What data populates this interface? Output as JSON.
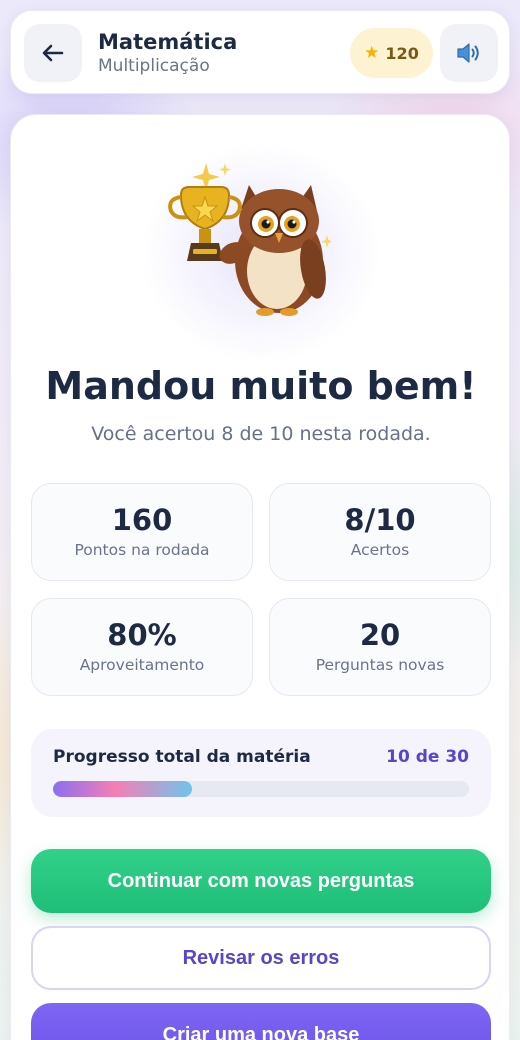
{
  "header": {
    "back_icon": "arrow-left-icon",
    "title": "Matemática",
    "subtitle": "Multiplicação",
    "score": "120",
    "score_icon": "star-icon",
    "sound_icon": "speaker-icon"
  },
  "result": {
    "mascot": "owl-with-trophy",
    "headline": "Mandou muito bem!",
    "summary": "Você acertou 8 de 10 nesta rodada."
  },
  "stats": [
    {
      "value": "160",
      "label": "Pontos na rodada"
    },
    {
      "value": "8/10",
      "label": "Acertos"
    },
    {
      "value": "80%",
      "label": "Aproveitamento"
    },
    {
      "value": "20",
      "label": "Perguntas novas"
    }
  ],
  "progress": {
    "label": "Progresso total da matéria",
    "count": "10 de 30",
    "fraction": 0.333
  },
  "actions": {
    "continue_label": "Continuar com novas perguntas",
    "review_label": "Revisar os erros",
    "new_base_label": "Criar uma nova base"
  },
  "colors": {
    "accent": "#5a45c8",
    "success": "#1fbe78",
    "primary_purple": "#6a52e8",
    "star": "#f5b400"
  }
}
